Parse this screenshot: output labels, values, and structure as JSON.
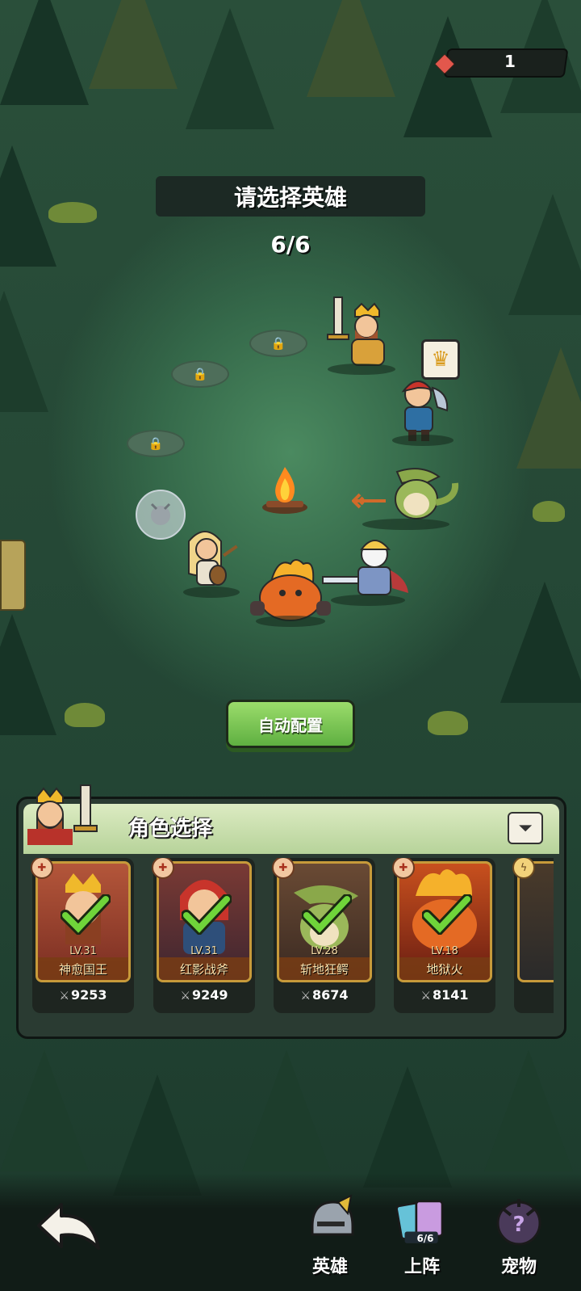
{
  "currency": {
    "icon": "crystal-icon",
    "value": "1"
  },
  "header": {
    "title": "请选择英雄",
    "counter": "6/6"
  },
  "auto_button": {
    "label": "自动配置"
  },
  "panel": {
    "title": "角色选择",
    "filter_icon": "filter-icon",
    "cards": [
      {
        "level": "LV.31",
        "name": "神愈国王",
        "power": "9253",
        "tag_icon": "dumbbell-icon",
        "selected": true
      },
      {
        "level": "LV.31",
        "name": "红影战斧",
        "power": "9249",
        "tag_icon": "dumbbell-icon",
        "selected": true
      },
      {
        "level": "LV.28",
        "name": "斩地狂鳄",
        "power": "8674",
        "tag_icon": "dumbbell-icon",
        "selected": true
      },
      {
        "level": "LV.18",
        "name": "地狱火",
        "power": "8141",
        "tag_icon": "dumbbell-icon",
        "selected": true
      }
    ]
  },
  "nav": {
    "back_icon": "back-arrow-icon",
    "items": [
      {
        "label": "英雄",
        "icon": "helmet-icon"
      },
      {
        "label": "上阵",
        "icon": "cards-icon",
        "badge": "6/6",
        "active": true
      },
      {
        "label": "宠物",
        "icon": "pet-egg-icon"
      }
    ]
  },
  "colors": {
    "accent_green": "#5fb041",
    "card_border": "#c79a3a",
    "check_green": "#6fd43a"
  }
}
